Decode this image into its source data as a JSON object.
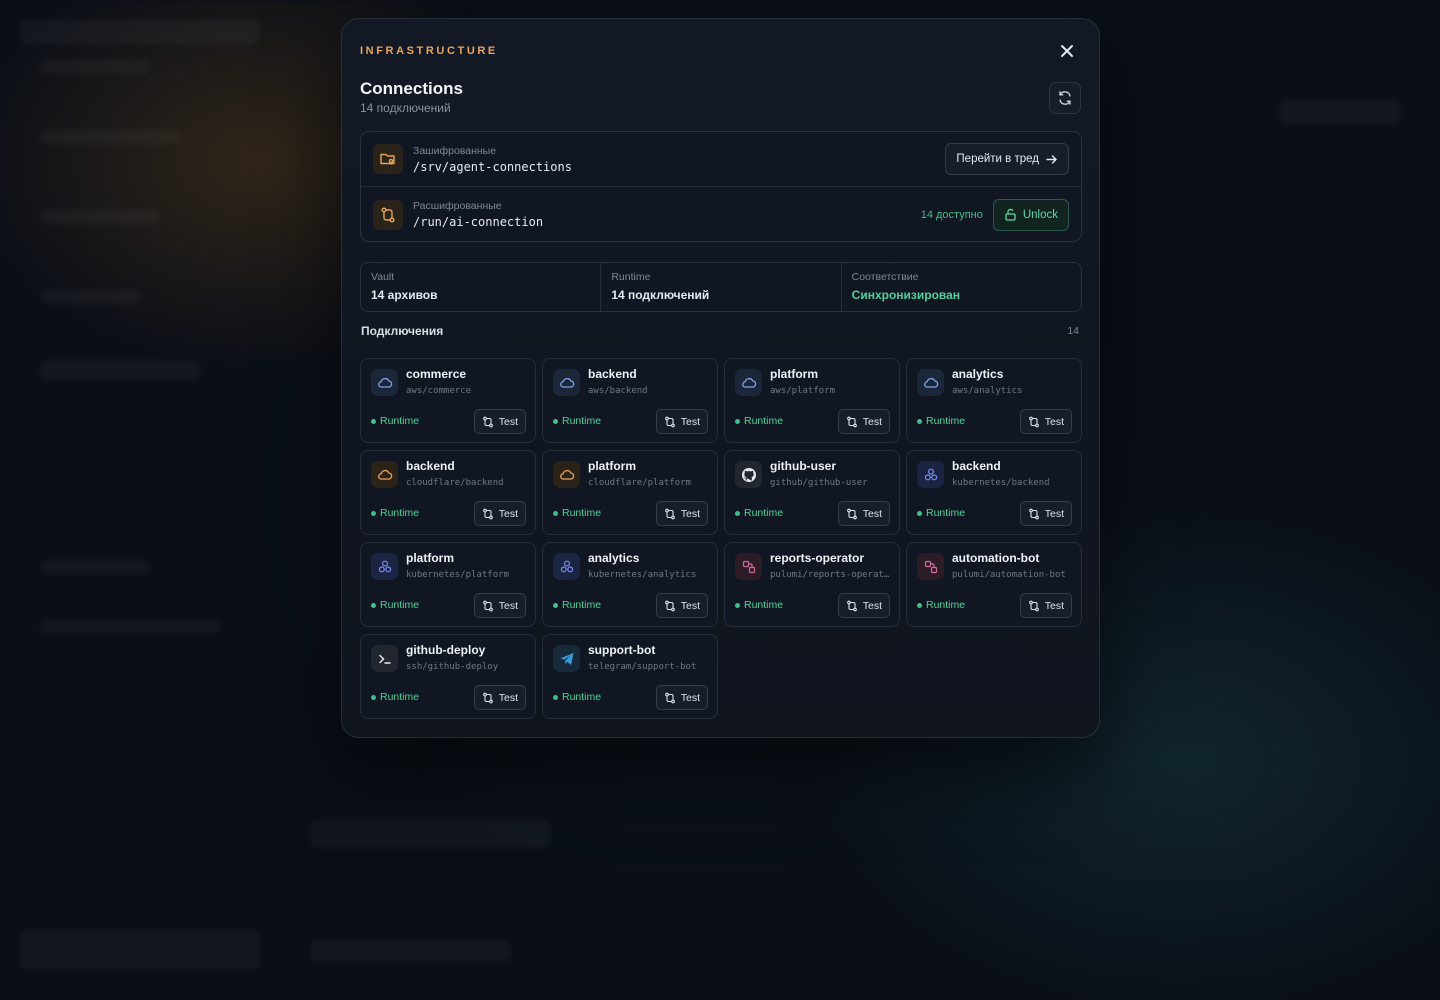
{
  "modal": {
    "eyebrow": "INFRASTRUCTURE",
    "title": "Connections",
    "subtitle": "14 подключений"
  },
  "paths": {
    "encrypted": {
      "label": "Зашифрованные",
      "value": "/srv/agent-connections",
      "action": "Перейти в тред"
    },
    "decrypted": {
      "label": "Расшифрованные",
      "value": "/run/ai-connection",
      "available": "14 доступно",
      "action": "Unlock"
    }
  },
  "stats": [
    {
      "label": "Vault",
      "value": "14 архивов"
    },
    {
      "label": "Runtime",
      "value": "14 подключений"
    },
    {
      "label": "Соответствие",
      "value": "Синхронизирован"
    }
  ],
  "section": {
    "title": "Подключения",
    "count": "14"
  },
  "colors": {
    "accent": "#e8a55a",
    "success": "#4fd09a"
  },
  "connections": [
    {
      "name": "commerce",
      "path": "aws/commerce",
      "icon": "cloud-icon",
      "kind": "aws",
      "status": "Runtime",
      "action": "Test"
    },
    {
      "name": "backend",
      "path": "aws/backend",
      "icon": "cloud-icon",
      "kind": "aws",
      "status": "Runtime",
      "action": "Test"
    },
    {
      "name": "platform",
      "path": "aws/platform",
      "icon": "cloud-icon",
      "kind": "aws",
      "status": "Runtime",
      "action": "Test"
    },
    {
      "name": "analytics",
      "path": "aws/analytics",
      "icon": "cloud-icon",
      "kind": "aws",
      "status": "Runtime",
      "action": "Test"
    },
    {
      "name": "backend",
      "path": "cloudflare/backend",
      "icon": "cloud-icon",
      "kind": "cf",
      "status": "Runtime",
      "action": "Test"
    },
    {
      "name": "platform",
      "path": "cloudflare/platform",
      "icon": "cloud-icon",
      "kind": "cf",
      "status": "Runtime",
      "action": "Test"
    },
    {
      "name": "github-user",
      "path": "github/github-user",
      "icon": "github-icon",
      "kind": "gh",
      "status": "Runtime",
      "action": "Test"
    },
    {
      "name": "backend",
      "path": "kubernetes/backend",
      "icon": "kubernetes-icon",
      "kind": "k8s",
      "status": "Runtime",
      "action": "Test"
    },
    {
      "name": "platform",
      "path": "kubernetes/platform",
      "icon": "kubernetes-icon",
      "kind": "k8s",
      "status": "Runtime",
      "action": "Test"
    },
    {
      "name": "analytics",
      "path": "kubernetes/analytics",
      "icon": "kubernetes-icon",
      "kind": "k8s",
      "status": "Runtime",
      "action": "Test"
    },
    {
      "name": "reports-operator",
      "path": "pulumi/reports-operator",
      "icon": "pulumi-icon",
      "kind": "pulumi",
      "status": "Runtime",
      "action": "Test"
    },
    {
      "name": "automation-bot",
      "path": "pulumi/automation-bot",
      "icon": "pulumi-icon",
      "kind": "pulumi",
      "status": "Runtime",
      "action": "Test"
    },
    {
      "name": "github-deploy",
      "path": "ssh/github-deploy",
      "icon": "terminal-icon",
      "kind": "ssh",
      "status": "Runtime",
      "action": "Test"
    },
    {
      "name": "support-bot",
      "path": "telegram/support-bot",
      "icon": "telegram-icon",
      "kind": "tg",
      "status": "Runtime",
      "action": "Test"
    }
  ]
}
